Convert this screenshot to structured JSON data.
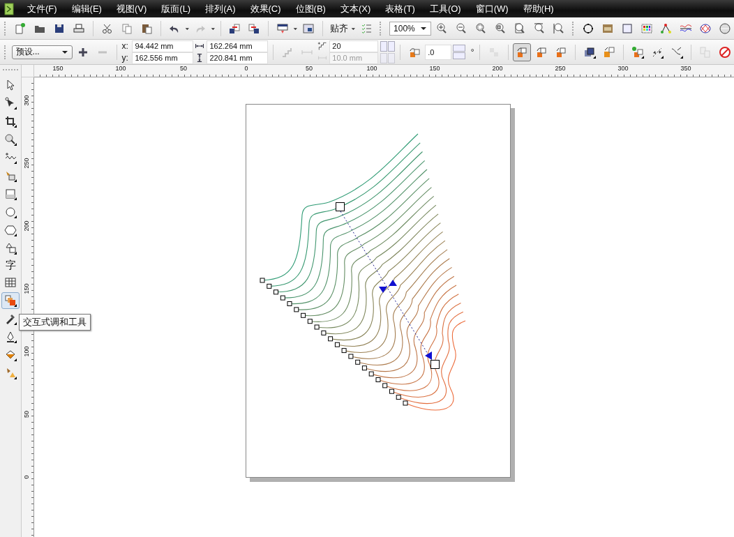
{
  "menu_bar": {
    "items": [
      "文件(F)",
      "编辑(E)",
      "视图(V)",
      "版面(L)",
      "排列(A)",
      "效果(C)",
      "位图(B)",
      "文本(X)",
      "表格(T)",
      "工具(O)",
      "窗口(W)",
      "帮助(H)"
    ]
  },
  "standard_toolbar": {
    "snap_label": "贴齐",
    "zoom_level": "100%"
  },
  "property_bar": {
    "preset": "预设...",
    "x_label": "x:",
    "x": "94.442 mm",
    "y_label": "y:",
    "y": "162.556 mm",
    "width": "162.264 mm",
    "height": "220.841 mm",
    "steps": "20",
    "spacing": {
      "value": "10.0 mm",
      "disabled": true
    },
    "angle": ".0",
    "angle_unit": "°",
    "blend_direction": [
      {
        "selected": true
      },
      {
        "selected": false
      },
      {
        "selected": false
      }
    ]
  },
  "toolbox": {
    "tools": [
      {
        "selected": false
      },
      {
        "selected": false
      },
      {
        "selected": false
      },
      {
        "selected": false
      },
      {
        "selected": false
      },
      {
        "selected": false
      },
      {
        "selected": false
      },
      {
        "selected": false
      },
      {
        "selected": false
      },
      {
        "selected": false
      },
      {
        "selected": false,
        "label": "字"
      },
      {
        "selected": false
      },
      {
        "selected": true
      },
      {
        "selected": false
      },
      {
        "selected": false
      },
      {
        "selected": false
      },
      {
        "selected": false
      }
    ],
    "tooltip": "交互式调和工具"
  },
  "rulers": {
    "horizontal": [
      "150",
      "100",
      "50",
      "0",
      "50",
      "100",
      "150",
      "200",
      "250",
      "300",
      "350"
    ],
    "vertical": [
      "300",
      "250",
      "200",
      "150",
      "100",
      "50",
      "0"
    ]
  }
}
